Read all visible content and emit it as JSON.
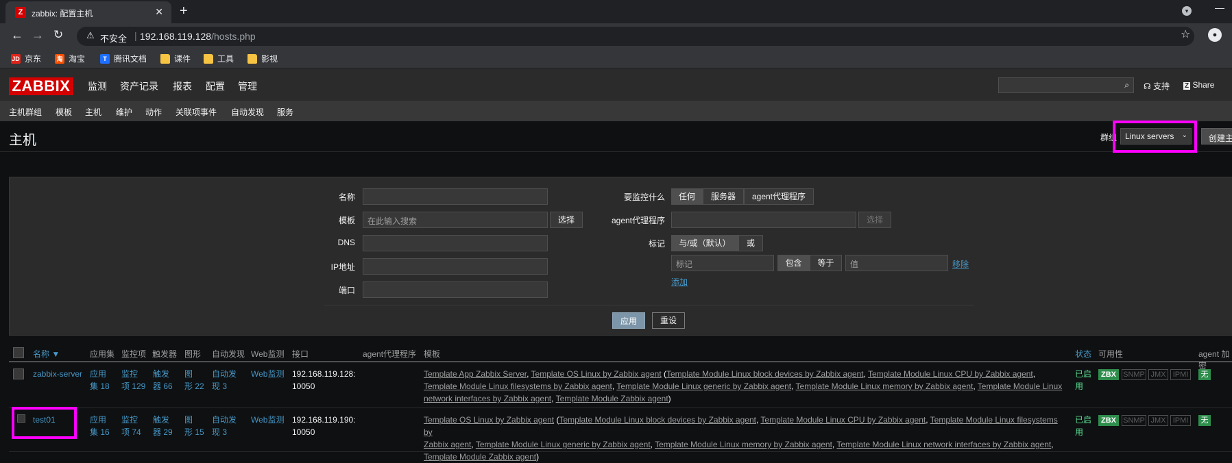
{
  "browser": {
    "tab_title": "zabbix: 配置主机",
    "tab_favicon": "Z",
    "close": "✕",
    "new_tab": "+",
    "insecure": "不安全",
    "url_host": "192.168.119.128",
    "url_path": "/hosts.php",
    "bookmarks": [
      {
        "label": "京东",
        "icon": "JD",
        "color": "#e1251b"
      },
      {
        "label": "淘宝",
        "icon": "淘",
        "color": "#ff5000"
      },
      {
        "label": "腾讯文档",
        "icon": "T",
        "color": "#1e6fff"
      },
      {
        "label": "课件",
        "icon": "folder-icon",
        "color": "#f6c343"
      },
      {
        "label": "工具",
        "icon": "folder-icon",
        "color": "#f6c343"
      },
      {
        "label": "影视",
        "icon": "folder-icon",
        "color": "#f6c343"
      }
    ]
  },
  "zabbix": {
    "logo": "ZABBIX",
    "menu": [
      "监测",
      "资产记录",
      "报表",
      "配置",
      "管理"
    ],
    "support": "支持",
    "share": "Share",
    "submenu": [
      "主机群组",
      "模板",
      "主机",
      "维护",
      "动作",
      "关联项事件",
      "自动发现",
      "服务"
    ],
    "active_submenu": "主机",
    "page_title": "主机",
    "group_label": "群组",
    "group_value": "Linux servers",
    "create_button": "创建主机"
  },
  "filter": {
    "name_label": "名称",
    "template_label": "模板",
    "template_placeholder": "在此输入搜索",
    "select_button": "选择",
    "dns_label": "DNS",
    "ip_label": "IP地址",
    "port_label": "端口",
    "monitor_label": "要监控什么",
    "monitor_options": [
      "任何",
      "服务器",
      "agent代理程序"
    ],
    "proxy_label": "agent代理程序",
    "proxy_select": "选择",
    "tags_label": "标记",
    "tag_mode": [
      "与/或（默认）",
      "或"
    ],
    "tag_placeholder": "标记",
    "tag_ops": [
      "包含",
      "等于"
    ],
    "value_placeholder": "值",
    "remove": "移除",
    "add": "添加",
    "apply": "应用",
    "reset": "重设"
  },
  "table": {
    "headers": {
      "name": "名称 ▼",
      "apps": "应用集",
      "items": "监控项",
      "triggers": "触发器",
      "graphs": "图形",
      "discovery": "自动发现",
      "web": "Web监测",
      "interface": "接口",
      "proxy": "agent代理程序",
      "templates": "模板",
      "status": "状态",
      "availability": "可用性",
      "encryption": "agent 加密"
    },
    "rows": [
      {
        "name": "zabbix-server",
        "apps_a": "应用",
        "apps_b": "集 18",
        "items_a": "监控",
        "items_b": "项 129",
        "triggers_a": "触发",
        "triggers_b": "器 66",
        "graphs_a": "图",
        "graphs_b": "形 22",
        "disc_a": "自动发",
        "disc_b": "现 3",
        "web": "Web监测",
        "iface_a": "192.168.119.128:",
        "iface_b": "10050",
        "tpl_line1a": "Template App Zabbix Server",
        "tpl_line1b": "Template OS Linux by Zabbix agent",
        "tpl_line1c": "Template Module Linux block devices by Zabbix agent",
        "tpl_line1d": "Template Module Linux CPU by Zabbix agent",
        "tpl_line2a": "Template Module Linux filesystems by Zabbix agent",
        "tpl_line2b": "Template Module Linux generic by Zabbix agent",
        "tpl_line2c": "Template Module Linux memory by Zabbix agent",
        "tpl_line2d": "Template Module Linux",
        "tpl_line3a": "network interfaces by Zabbix agent",
        "tpl_line3b": "Template Module Zabbix agent",
        "status_a": "已启",
        "status_b": "用",
        "zbx": "ZBX",
        "snmp": "SNMP",
        "jmx": "JMX",
        "ipmi": "IPMI",
        "enc": "无"
      },
      {
        "name": "test01",
        "apps_a": "应用",
        "apps_b": "集 16",
        "items_a": "监控",
        "items_b": "项 74",
        "triggers_a": "触发",
        "triggers_b": "器 29",
        "graphs_a": "图",
        "graphs_b": "形 15",
        "disc_a": "自动发",
        "disc_b": "现 3",
        "web": "Web监测",
        "iface_a": "192.168.119.190:",
        "iface_b": "10050",
        "tpl_line1a": "Template OS Linux by Zabbix agent",
        "tpl_line1b": "Template Module Linux block devices by Zabbix agent",
        "tpl_line1c": "Template Module Linux CPU by Zabbix agent",
        "tpl_line1d": "Template Module Linux filesystems by",
        "tpl_line2a": "Zabbix agent",
        "tpl_line2b": "Template Module Linux generic by Zabbix agent",
        "tpl_line2c": "Template Module Linux memory by Zabbix agent",
        "tpl_line2d": "Template Module Linux network interfaces by Zabbix agent",
        "tpl_line3a": "Template Module Zabbix agent",
        "status_a": "已启",
        "status_b": "用",
        "zbx": "ZBX",
        "snmp": "SNMP",
        "jmx": "JMX",
        "ipmi": "IPMI",
        "enc": "无"
      }
    ]
  }
}
